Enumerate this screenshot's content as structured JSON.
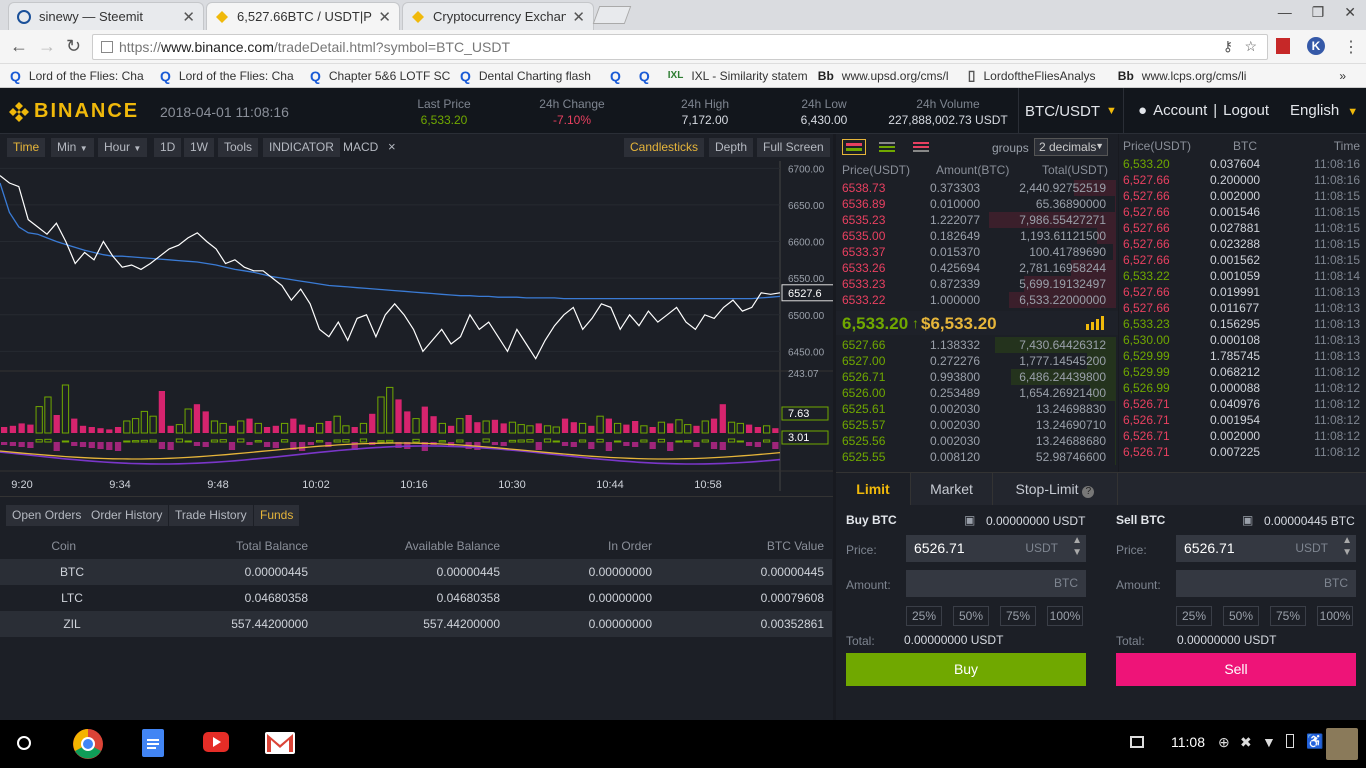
{
  "browser": {
    "tabs": [
      {
        "title": "sinewy — Steemit",
        "active": false
      },
      {
        "title": "6,527.66BTC / USDT|Pro",
        "active": true
      },
      {
        "title": "Cryptocurrency Exchang",
        "active": false
      }
    ],
    "url_prefix": "https://",
    "url_host": "www.binance.com",
    "url_path": "/tradeDetail.html?symbol=BTC_USDT",
    "bookmarks": [
      {
        "icon": "Q",
        "label": "Lord of the Flies: Cha"
      },
      {
        "icon": "Q",
        "label": "Lord of the Flies: Cha"
      },
      {
        "icon": "Q",
        "label": "Chapter 5&6 LOTF SC"
      },
      {
        "icon": "Q",
        "label": "Dental Charting flash"
      },
      {
        "icon": "Q",
        "label": ""
      },
      {
        "icon": "Q",
        "label": ""
      },
      {
        "icon": "IXL",
        "label": "IXL - Similarity statem"
      },
      {
        "icon": "Bb",
        "label": "www.upsd.org/cms/l"
      },
      {
        "icon": "▯",
        "label": "LordoftheFliesAnalys"
      },
      {
        "icon": "Bb",
        "label": "www.lcps.org/cms/li"
      }
    ],
    "more": "»"
  },
  "header": {
    "logo": "BINANCE",
    "datetime": "2018-04-01 11:08:16",
    "stats": [
      {
        "label": "Last Price",
        "value": "6,533.20",
        "color": "#70a800"
      },
      {
        "label": "24h Change",
        "value": "-7.10%",
        "color": "#e84060"
      },
      {
        "label": "24h High",
        "value": "7,172.00",
        "color": "#d7dbe2"
      },
      {
        "label": "24h Low",
        "value": "6,430.00",
        "color": "#d7dbe2"
      },
      {
        "label": "24h Volume",
        "value": "227,888,002.73 USDT",
        "color": "#d7dbe2"
      }
    ],
    "pair": "BTC/USDT",
    "account": "Account",
    "sep": "|",
    "logout": "Logout",
    "language": "English"
  },
  "chart_toolbar": {
    "buttons": [
      "Time",
      "Min",
      "Hour",
      "1D",
      "1W",
      "Tools",
      "INDICATOR"
    ],
    "indicator": "MACD",
    "close": "×",
    "right_buttons": [
      "Candlesticks",
      "Depth",
      "Full Screen"
    ]
  },
  "chart_data": {
    "type": "line",
    "x_ticks": [
      "9:20",
      "9:34",
      "9:48",
      "10:02",
      "10:16",
      "10:30",
      "10:44",
      "10:58"
    ],
    "y_ticks": [
      "6700.00",
      "6650.00",
      "6600.00",
      "6550.00",
      "6500.00",
      "6450.00"
    ],
    "ylim": [
      6430,
      6710
    ],
    "last_value_label": "6527.6",
    "price": [
      6690,
      6680,
      6675,
      6630,
      6620,
      6610,
      6625,
      6600,
      6570,
      6585,
      6575,
      6600,
      6580,
      6565,
      6568,
      6562,
      6570,
      6580,
      6590,
      6595,
      6605,
      6612,
      6600,
      6590,
      6570,
      6575,
      6565,
      6560,
      6560,
      6550,
      6540,
      6520,
      6535,
      6515,
      6480,
      6470,
      6490,
      6465,
      6495,
      6500,
      6470,
      6500,
      6515,
      6500,
      6480,
      6450,
      6465,
      6480,
      6460,
      6470,
      6500,
      6480,
      6490,
      6470,
      6450,
      6480,
      6460,
      6440,
      6465,
      6485,
      6500,
      6510,
      6480,
      6495,
      6515,
      6510,
      6480,
      6500,
      6485,
      6505,
      6490,
      6500,
      6510,
      6490,
      6480,
      6500,
      6495,
      6510,
      6520,
      6505,
      6510,
      6530,
      6528,
      6530
    ],
    "ma": [
      6680,
      6640,
      6620,
      6612,
      6610,
      6605,
      6600,
      6596,
      6592,
      6588,
      6585,
      6582,
      6580,
      6580,
      6579,
      6578,
      6577,
      6576,
      6575,
      6574,
      6573,
      6572,
      6570,
      6568,
      6565,
      6562,
      6560,
      6558,
      6555,
      6552,
      6550,
      6548,
      6546,
      6544,
      6542,
      6540,
      6539,
      6538,
      6537,
      6536,
      6535,
      6534,
      6533,
      6532,
      6531,
      6530,
      6529,
      6528,
      6527,
      6526,
      6526,
      6525,
      6525,
      6524,
      6524,
      6524,
      6523,
      6523,
      6523,
      6523,
      6522,
      6522,
      6522,
      6522,
      6522,
      6522,
      6522,
      6522,
      6522,
      6522,
      6522,
      6522,
      6522,
      6522,
      6522,
      6522,
      6522,
      6522,
      6522,
      6522,
      6522,
      6523,
      6524,
      6525
    ],
    "volume_max_label": "243.07",
    "macd_labels": [
      "7.63",
      "3.01"
    ],
    "volume": [
      5,
      6,
      8,
      7,
      22,
      30,
      15,
      40,
      12,
      6,
      5,
      4,
      3,
      5,
      10,
      12,
      18,
      14,
      35,
      6,
      7,
      20,
      24,
      18,
      10,
      8,
      6,
      10,
      12,
      8,
      5,
      6,
      8,
      12,
      7,
      5,
      8,
      10,
      14,
      6,
      5,
      8,
      16,
      30,
      38,
      28,
      18,
      12,
      22,
      14,
      8,
      6,
      12,
      15,
      9,
      10,
      11,
      8,
      9,
      7,
      6,
      8,
      6,
      5,
      12,
      9,
      8,
      6,
      14,
      12,
      8,
      7,
      10,
      6,
      5,
      9,
      8,
      11,
      7,
      6,
      10,
      12,
      24,
      9,
      8,
      7,
      5,
      6,
      4
    ],
    "volume_up": [
      false,
      false,
      false,
      false,
      true,
      true,
      false,
      true,
      false,
      false,
      false,
      false,
      false,
      false,
      true,
      true,
      true,
      true,
      false,
      false,
      true,
      true,
      false,
      false,
      true,
      true,
      false,
      true,
      false,
      true,
      false,
      false,
      true,
      false,
      false,
      false,
      true,
      false,
      true,
      true,
      false,
      true,
      false,
      true,
      true,
      false,
      false,
      true,
      false,
      false,
      true,
      false,
      true,
      false,
      false,
      true,
      false,
      false,
      true,
      true,
      true,
      false,
      true,
      true,
      false,
      false,
      true,
      false,
      true,
      false,
      true,
      false,
      false,
      true,
      false,
      true,
      false,
      true,
      true,
      false,
      true,
      false,
      false,
      true,
      true,
      false,
      false,
      true,
      false
    ]
  },
  "orderbook": {
    "groups_label": "groups",
    "decimals": "2 decimals",
    "headers": [
      "Price(USDT)",
      "Amount(BTC)",
      "Total(USDT)"
    ],
    "asks": [
      {
        "p": "6538.73",
        "a": "0.373303",
        "t": "2,440.92752519",
        "d": 0.32
      },
      {
        "p": "6536.89",
        "a": "0.010000",
        "t": "65.36890000",
        "d": 0.01
      },
      {
        "p": "6535.23",
        "a": "1.222077",
        "t": "7,986.55427271",
        "d": 0.98
      },
      {
        "p": "6535.00",
        "a": "0.182649",
        "t": "1,193.61121500",
        "d": 0.15
      },
      {
        "p": "6533.37",
        "a": "0.015370",
        "t": "100.41789690",
        "d": 0.02
      },
      {
        "p": "6533.26",
        "a": "0.425694",
        "t": "2,781.16958244",
        "d": 0.35
      },
      {
        "p": "6533.23",
        "a": "0.872339",
        "t": "5,699.19132497",
        "d": 0.71
      },
      {
        "p": "6533.22",
        "a": "1.000000",
        "t": "6,533.22000000",
        "d": 0.82
      }
    ],
    "last_price": "6,533.20",
    "arrow": "↑",
    "last_usd": "$6,533.20",
    "bids": [
      {
        "p": "6527.66",
        "a": "1.138332",
        "t": "7,430.64426312",
        "d": 0.93
      },
      {
        "p": "6527.00",
        "a": "0.272276",
        "t": "1,777.14545200",
        "d": 0.22
      },
      {
        "p": "6526.71",
        "a": "0.993800",
        "t": "6,486.24439800",
        "d": 0.81
      },
      {
        "p": "6526.00",
        "a": "0.253489",
        "t": "1,654.26921400",
        "d": 0.2
      },
      {
        "p": "6525.61",
        "a": "0.002030",
        "t": "13.24698830",
        "d": 0.01
      },
      {
        "p": "6525.57",
        "a": "0.002030",
        "t": "13.24690710",
        "d": 0.01
      },
      {
        "p": "6525.56",
        "a": "0.002030",
        "t": "13.24688680",
        "d": 0.01
      },
      {
        "p": "6525.55",
        "a": "0.008120",
        "t": "52.98746600",
        "d": 0.01
      }
    ]
  },
  "trades": {
    "headers": [
      "Price(USDT)",
      "BTC",
      "Time"
    ],
    "rows": [
      {
        "p": "6,533.20",
        "a": "0.037604",
        "t": "11:08:16",
        "up": true
      },
      {
        "p": "6,527.66",
        "a": "0.200000",
        "t": "11:08:16",
        "up": false
      },
      {
        "p": "6,527.66",
        "a": "0.002000",
        "t": "11:08:15",
        "up": false
      },
      {
        "p": "6,527.66",
        "a": "0.001546",
        "t": "11:08:15",
        "up": false
      },
      {
        "p": "6,527.66",
        "a": "0.027881",
        "t": "11:08:15",
        "up": false
      },
      {
        "p": "6,527.66",
        "a": "0.023288",
        "t": "11:08:15",
        "up": false
      },
      {
        "p": "6,527.66",
        "a": "0.001562",
        "t": "11:08:15",
        "up": false
      },
      {
        "p": "6,533.22",
        "a": "0.001059",
        "t": "11:08:14",
        "up": true
      },
      {
        "p": "6,527.66",
        "a": "0.019991",
        "t": "11:08:13",
        "up": false
      },
      {
        "p": "6,527.66",
        "a": "0.011677",
        "t": "11:08:13",
        "up": false
      },
      {
        "p": "6,533.23",
        "a": "0.156295",
        "t": "11:08:13",
        "up": true
      },
      {
        "p": "6,530.00",
        "a": "0.000108",
        "t": "11:08:13",
        "up": true
      },
      {
        "p": "6,529.99",
        "a": "1.785745",
        "t": "11:08:13",
        "up": true
      },
      {
        "p": "6,529.99",
        "a": "0.068212",
        "t": "11:08:12",
        "up": true
      },
      {
        "p": "6,526.99",
        "a": "0.000088",
        "t": "11:08:12",
        "up": true
      },
      {
        "p": "6,526.71",
        "a": "0.040976",
        "t": "11:08:12",
        "up": false
      },
      {
        "p": "6,526.71",
        "a": "0.001954",
        "t": "11:08:12",
        "up": false
      },
      {
        "p": "6,526.71",
        "a": "0.002000",
        "t": "11:08:12",
        "up": false
      },
      {
        "p": "6,526.71",
        "a": "0.007225",
        "t": "11:08:12",
        "up": false
      }
    ]
  },
  "funds": {
    "tabs": [
      "Open Orders",
      "Order History",
      "Trade History",
      "Funds"
    ],
    "headers": [
      "Coin",
      "Total Balance",
      "Available Balance",
      "In Order",
      "BTC Value"
    ],
    "rows": [
      [
        "BTC",
        "0.00000445",
        "0.00000445",
        "0.00000000",
        "0.00000445"
      ],
      [
        "LTC",
        "0.04680358",
        "0.04680358",
        "0.00000000",
        "0.00079608"
      ],
      [
        "ZIL",
        "557.44200000",
        "557.44200000",
        "0.00000000",
        "0.00352861"
      ]
    ]
  },
  "orderform": {
    "tabs": [
      "Limit",
      "Market",
      "Stop-Limit"
    ],
    "buy": {
      "title": "Buy BTC",
      "balance": "0.00000000 USDT",
      "price_label": "Price:",
      "price": "6526.71",
      "price_unit": "USDT",
      "amount_label": "Amount:",
      "amount_unit": "BTC",
      "total_label": "Total:",
      "total": "0.00000000 USDT",
      "button": "Buy"
    },
    "sell": {
      "title": "Sell BTC",
      "balance": "0.00000445 BTC",
      "price_label": "Price:",
      "price": "6526.71",
      "price_unit": "USDT",
      "amount_label": "Amount:",
      "amount_unit": "BTC",
      "total_label": "Total:",
      "total": "0.00000000 USDT",
      "button": "Sell"
    },
    "pcts": [
      "25%",
      "50%",
      "75%",
      "100%"
    ]
  },
  "taskbar": {
    "time": "11:08"
  },
  "colors": {
    "green": "#70a800",
    "red": "#e84060",
    "gold": "#f0b90b",
    "buy_btn": "#70a800",
    "sell_btn": "#ee1478"
  }
}
